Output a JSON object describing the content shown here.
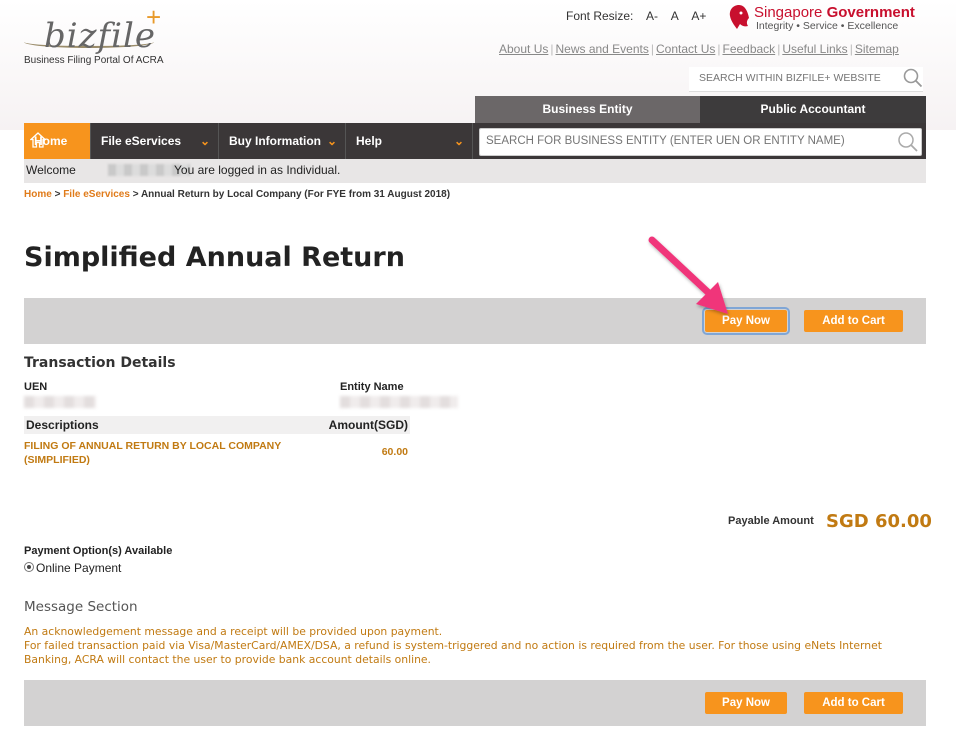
{
  "header": {
    "logo_text": "bizfile",
    "logo_plus": "+",
    "logo_tagline": "Business Filing Portal Of ACRA",
    "font_resize_label": "Font Resize:",
    "font_sizes": [
      "A-",
      "A",
      "A+"
    ],
    "gov_name_1": "Singapore",
    "gov_name_2": "Government",
    "gov_tagline": "Integrity • Service • Excellence",
    "links": [
      "About Us",
      "News and Events",
      "Contact Us",
      "Feedback",
      "Useful Links",
      "Sitemap"
    ],
    "site_search_placeholder": "SEARCH WITHIN BIZFILE+ WEBSITE"
  },
  "tabs": {
    "business_entity": "Business Entity",
    "public_accountant": "Public Accountant"
  },
  "nav": {
    "home": "Home",
    "file_eservices": "File eServices",
    "buy_information": "Buy Information",
    "help": "Help",
    "entity_search_placeholder": "SEARCH FOR BUSINESS ENTITY (ENTER UEN OR ENTITY NAME)"
  },
  "welcome": {
    "prefix": "Welcome",
    "suffix": "You are logged in as Individual."
  },
  "breadcrumb": {
    "home": "Home",
    "file_eservices": "File eServices",
    "current": "Annual Return by Local Company (For FYE from 31 August 2018)"
  },
  "page": {
    "title": "Simplified Annual Return"
  },
  "actions": {
    "pay_now": "Pay Now",
    "add_to_cart": "Add to Cart"
  },
  "transaction": {
    "heading": "Transaction Details",
    "uen_label": "UEN",
    "entity_name_label": "Entity Name",
    "desc_header": "Descriptions",
    "amount_header": "Amount(SGD)",
    "items": [
      {
        "description": "FILING OF ANNUAL RETURN BY LOCAL COMPANY (SIMPLIFIED)",
        "amount": "60.00"
      }
    ],
    "payable_label": "Payable Amount",
    "payable_value": "SGD  60.00"
  },
  "payment": {
    "label": "Payment Option(s) Available",
    "option": "Online Payment"
  },
  "message": {
    "title": "Message Section",
    "lines": [
      "An acknowledgement message and a receipt will be provided upon payment.",
      "For failed transaction paid via Visa/MasterCard/AMEX/DSA, a refund is system-triggered and no action is required from the user. For those using eNets Internet Banking, ACRA will contact the user to provide bank account details online."
    ]
  },
  "colors": {
    "accent_orange": "#f7941d",
    "nav_dark": "#3b3738",
    "text_orange": "#c17a12",
    "gov_red": "#c8102e",
    "annotation_arrow": "#f0357a"
  }
}
